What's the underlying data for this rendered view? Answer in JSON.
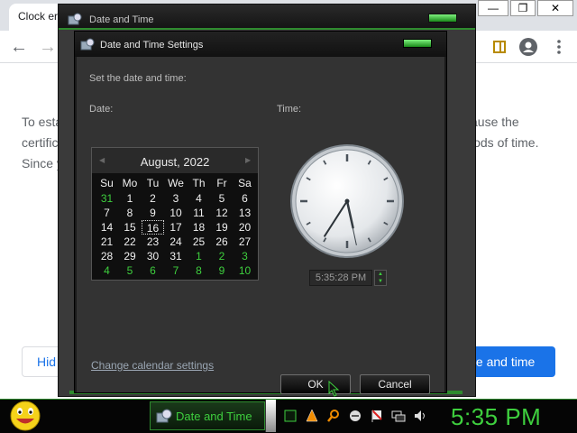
{
  "browser": {
    "tab_title": "Clock er",
    "body_lines": [
      "To esta",
      "certific",
      "Since y"
    ],
    "body_right": [
      "ause the",
      "iods of time."
    ],
    "hide_label": "Hid",
    "set_button": "te and time"
  },
  "outer_dialog": {
    "title": "Date and Time"
  },
  "dialog": {
    "title": "Date and Time Settings",
    "instruction": "Set the date and time:",
    "date_label": "Date:",
    "time_label": "Time:",
    "month_title": "August, 2022",
    "weekdays": [
      "Su",
      "Mo",
      "Tu",
      "We",
      "Th",
      "Fr",
      "Sa"
    ],
    "weeks": [
      [
        "31",
        "1",
        "2",
        "3",
        "4",
        "5",
        "6"
      ],
      [
        "7",
        "8",
        "9",
        "10",
        "11",
        "12",
        "13"
      ],
      [
        "14",
        "15",
        "16",
        "17",
        "18",
        "19",
        "20"
      ],
      [
        "21",
        "22",
        "23",
        "24",
        "25",
        "26",
        "27"
      ],
      [
        "28",
        "29",
        "30",
        "31",
        "1",
        "2",
        "3"
      ],
      [
        "4",
        "5",
        "6",
        "7",
        "8",
        "9",
        "10"
      ]
    ],
    "time_value": "5:35:28 PM",
    "change_link": "Change calendar settings",
    "ok_label": "OK",
    "cancel_label": "Cancel"
  },
  "clock": {
    "hour": 5,
    "minute": 35,
    "second": 28
  },
  "taskbar": {
    "task_label": "Date and Time",
    "clock": "5:35 PM"
  },
  "colors": {
    "accent_green": "#3ecf3e",
    "chrome_blue": "#1a73e8"
  }
}
